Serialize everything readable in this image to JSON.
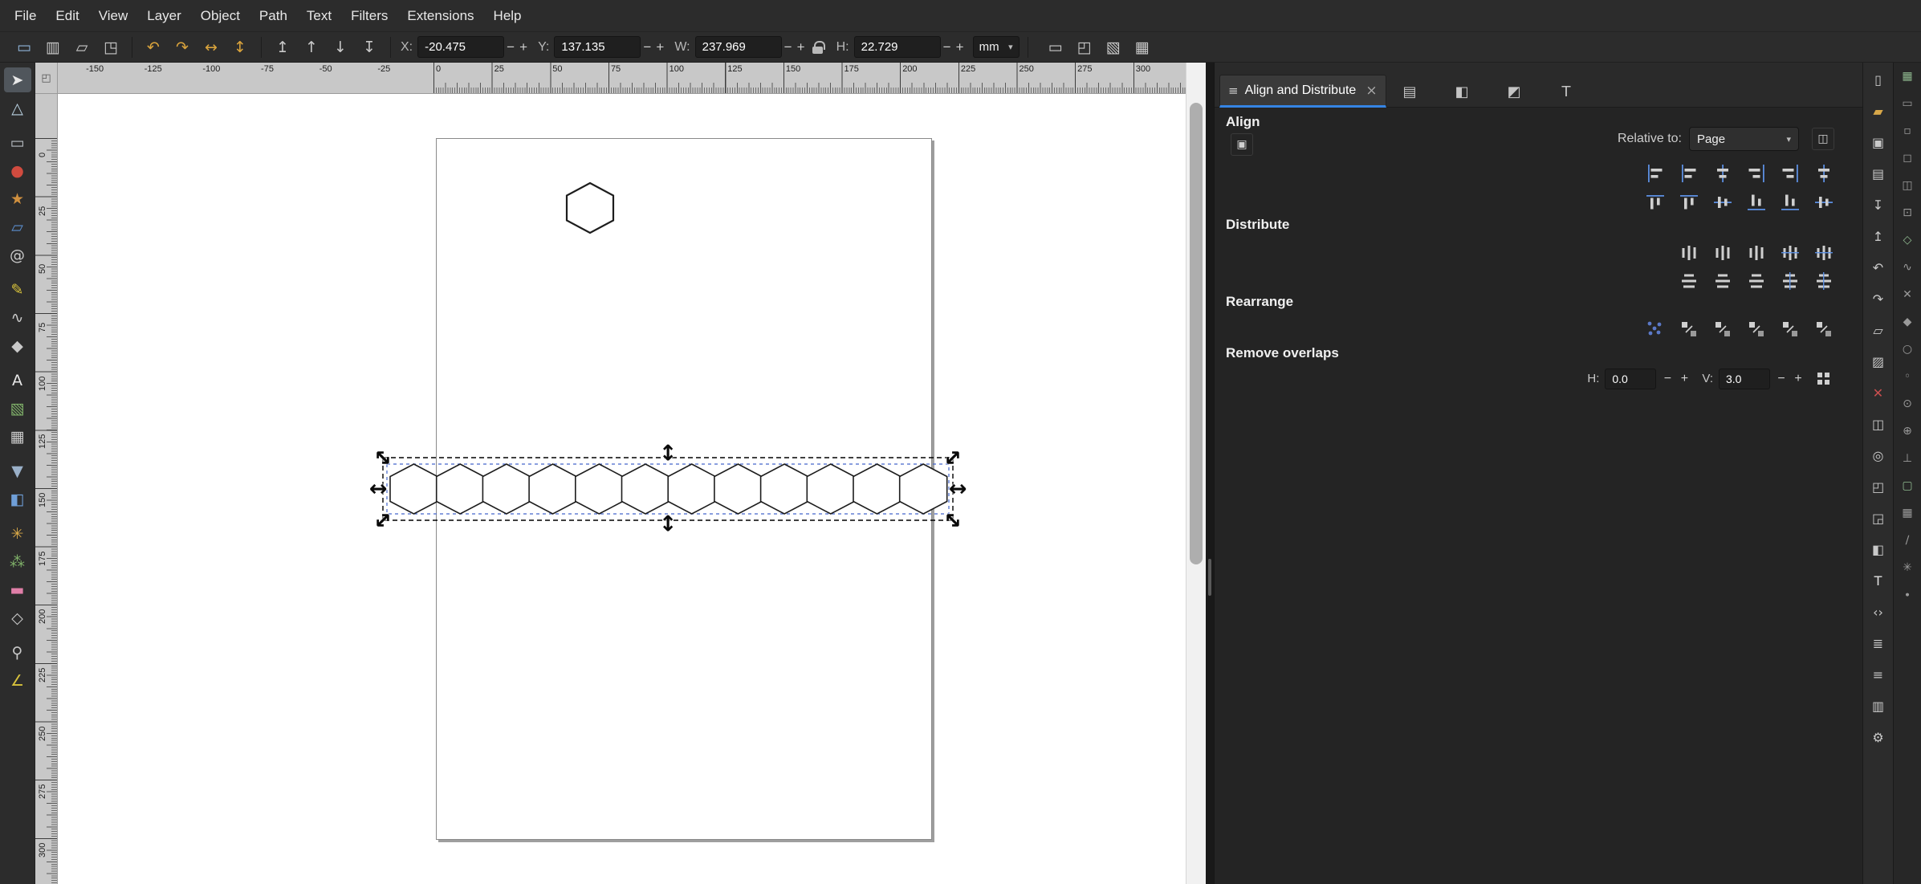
{
  "menubar": {
    "items": [
      "File",
      "Edit",
      "View",
      "Layer",
      "Object",
      "Path",
      "Text",
      "Filters",
      "Extensions",
      "Help"
    ]
  },
  "spinner": {
    "minus": "−",
    "plus": "+"
  },
  "command_toolbar": {
    "groups": [
      [
        {
          "name": "select-all",
          "glyph": "▭",
          "color": "#8fb4d8"
        },
        {
          "name": "select-all-in-all-layers",
          "glyph": "▥",
          "color": "#c9c9c9"
        },
        {
          "name": "deselect",
          "glyph": "▱",
          "color": "#c9c9c9"
        },
        {
          "name": "selection-options",
          "glyph": "◳",
          "color": "#c9c9c9"
        }
      ],
      [
        {
          "name": "rotate-90-ccw",
          "glyph": "↶",
          "color": "#d9a33c"
        },
        {
          "name": "rotate-90-cw",
          "glyph": "↷",
          "color": "#d9a33c"
        },
        {
          "name": "flip-horizontal",
          "glyph": "↔",
          "color": "#d9a33c"
        },
        {
          "name": "flip-vertical",
          "glyph": "↕",
          "color": "#d9a33c"
        }
      ],
      [
        {
          "name": "raise-to-top",
          "glyph": "↥",
          "color": "#c9c9c9"
        },
        {
          "name": "raise",
          "glyph": "↑",
          "color": "#c9c9c9"
        },
        {
          "name": "lower",
          "glyph": "↓",
          "color": "#c9c9c9"
        },
        {
          "name": "lower-to-bottom",
          "glyph": "↧",
          "color": "#c9c9c9"
        }
      ]
    ],
    "fields": [
      {
        "name": "x",
        "label": "X:",
        "value": "-20.475"
      },
      {
        "name": "y",
        "label": "Y:",
        "value": "137.135"
      },
      {
        "name": "w",
        "label": "W:",
        "value": "237.969"
      },
      {
        "name": "h",
        "label": "H:",
        "value": "22.729"
      }
    ],
    "lock_icon_name": "lock-aspect-ratio-toggle",
    "unit_value": "mm",
    "caret_glyph": "▾",
    "right_group": [
      {
        "name": "scale-stroke-with-object",
        "glyph": "▭",
        "color": "#c9c9c9"
      },
      {
        "name": "scale-rounded-corners",
        "glyph": "◰",
        "color": "#c9c9c9"
      },
      {
        "name": "move-gradients-with-object",
        "glyph": "▧",
        "color": "#c9c9c9"
      },
      {
        "name": "move-patterns-with-object",
        "glyph": "▦",
        "color": "#c9c9c9"
      }
    ]
  },
  "toolbox": [
    {
      "name": "selector-tool",
      "glyph": "➤",
      "color": "#e8e8e8",
      "active": true
    },
    {
      "name": "node-tool",
      "glyph": "△",
      "color": "#bcd4e4"
    },
    {
      "name": "rectangle-tool",
      "glyph": "▭",
      "color": "#b9bec4",
      "gap": true
    },
    {
      "name": "ellipse-tool",
      "glyph": "●",
      "color": "#d04b3f"
    },
    {
      "name": "star-tool",
      "glyph": "★",
      "color": "#d0903f"
    },
    {
      "name": "box-3d-tool",
      "glyph": "▱",
      "color": "#5b8fd0"
    },
    {
      "name": "spiral-tool",
      "glyph": "@",
      "color": "#c9c9c9"
    },
    {
      "name": "pencil-tool",
      "glyph": "✎",
      "color": "#d8c23c",
      "gap": true
    },
    {
      "name": "pen-tool",
      "glyph": "∿",
      "color": "#c9c9c9"
    },
    {
      "name": "calligraphy-tool",
      "glyph": "◆",
      "color": "#c9c9c9"
    },
    {
      "name": "text-tool",
      "glyph": "A",
      "color": "#e8e8e8",
      "gap": true
    },
    {
      "name": "gradient-tool",
      "glyph": "▧",
      "color": "#7fb069"
    },
    {
      "name": "mesh-gradient-tool",
      "glyph": "▦",
      "color": "#c9c9c9"
    },
    {
      "name": "dropper-tool",
      "glyph": "▼",
      "color": "#9ab0c8",
      "gap": true
    },
    {
      "name": "paint-bucket-tool",
      "glyph": "◧",
      "color": "#6f9fd8"
    },
    {
      "name": "tweak-tool",
      "glyph": "✳",
      "color": "#d8a849",
      "gap": true
    },
    {
      "name": "spray-tool",
      "glyph": "⁂",
      "color": "#7fb069"
    },
    {
      "name": "eraser-tool",
      "glyph": "▬",
      "color": "#e07fa8"
    },
    {
      "name": "connector-tool",
      "glyph": "◇",
      "color": "#c9c9c9"
    },
    {
      "name": "zoom-tool",
      "glyph": "⚲",
      "color": "#c9c9c9",
      "gap": true
    },
    {
      "name": "measure-tool",
      "glyph": "∠",
      "color": "#d8c23c"
    }
  ],
  "rulers": {
    "horizontal": [
      "-150",
      "-125",
      "-100",
      "-75",
      "-50",
      "-25",
      "0",
      "25",
      "50",
      "75",
      "100",
      "125",
      "150",
      "175",
      "200",
      "225",
      "250",
      "275",
      "300"
    ],
    "vertical": [
      "0",
      "25",
      "50",
      "75",
      "100",
      "125",
      "150",
      "175",
      "200",
      "225",
      "250",
      "275",
      "300"
    ]
  },
  "canvas": {
    "hexagon_row_count": 12,
    "selection_handles": [
      {
        "name": "scale-handle-nw",
        "glyph": "↔",
        "rot": 45
      },
      {
        "name": "scale-handle-n",
        "glyph": "↕",
        "rot": 0
      },
      {
        "name": "scale-handle-ne",
        "glyph": "↔",
        "rot": -45
      },
      {
        "name": "scale-handle-w",
        "glyph": "↔",
        "rot": 0
      },
      {
        "name": "scale-handle-e",
        "glyph": "↔",
        "rot": 0
      },
      {
        "name": "scale-handle-sw",
        "glyph": "↔",
        "rot": -45
      },
      {
        "name": "scale-handle-s",
        "glyph": "↕",
        "rot": 0
      },
      {
        "name": "scale-handle-se",
        "glyph": "↔",
        "rot": 45
      }
    ]
  },
  "corner_icon": {
    "name": "ruler-corner",
    "glyph": "◰"
  },
  "dock": {
    "tab": {
      "icon_glyph": "≡",
      "title": "Align and Distribute",
      "close_glyph": "×"
    },
    "tab_icons": [
      {
        "name": "tab-document-properties",
        "glyph": "▤"
      },
      {
        "name": "tab-export",
        "glyph": "◧"
      },
      {
        "name": "tab-fill-stroke",
        "glyph": "◩"
      },
      {
        "name": "tab-text-and-font",
        "glyph": "T"
      }
    ],
    "align": {
      "title": "Align",
      "group_toggle": {
        "name": "treat-selection-as-group",
        "glyph": "▣"
      },
      "relative_label": "Relative to:",
      "relative_value": "Page",
      "caret_glyph": "▾",
      "move_as_group": {
        "name": "move-as-group",
        "glyph": "◫"
      },
      "row1": [
        "align-right-to-anchor-left",
        "align-left-edges",
        "center-on-vertical-axis",
        "align-right-edges",
        "align-left-to-anchor-right",
        "align-text-horizontal"
      ],
      "row2": [
        "align-bottom-to-anchor-top",
        "align-top-edges",
        "center-on-horizontal-axis",
        "align-bottom-edges",
        "align-top-to-anchor-bottom",
        "align-text-vertical"
      ]
    },
    "distribute": {
      "title": "Distribute",
      "row1": [
        "distribute-left-edges",
        "distribute-centers-horizontally",
        "distribute-right-edges",
        "distribute-equal-gaps-horizontally",
        "distribute-text-anchors-horizontally"
      ],
      "row2": [
        "distribute-top-edges",
        "distribute-centers-vertically",
        "distribute-bottom-edges",
        "distribute-equal-gaps-vertically",
        "distribute-text-anchors-vertically"
      ]
    },
    "rearrange": {
      "title": "Rearrange",
      "row": [
        "arrange-as-graph",
        "exchange-in-selection-order",
        "exchange-in-stacking-order",
        "exchange-clockwise",
        "randomize-centers",
        "unclump"
      ]
    },
    "remove_overlaps": {
      "title": "Remove overlaps",
      "h_label": "H:",
      "h_value": "0.0",
      "v_label": "V:",
      "v_value": "3.0",
      "button": {
        "name": "remove-overlaps-apply",
        "glyph": "▦"
      }
    }
  },
  "right_bars": {
    "commands": [
      {
        "name": "new-document",
        "glyph": "▯",
        "color": "#c9c9c9"
      },
      {
        "name": "open-document",
        "glyph": "▰",
        "color": "#d8a849"
      },
      {
        "name": "save-document",
        "glyph": "▣",
        "color": "#c9c9c9"
      },
      {
        "name": "print-document",
        "glyph": "▤",
        "color": "#c9c9c9"
      },
      {
        "name": "import-image",
        "glyph": "↧",
        "color": "#c9c9c9"
      },
      {
        "name": "export-image",
        "glyph": "↥",
        "color": "#c9c9c9"
      },
      {
        "name": "undo",
        "glyph": "↶",
        "color": "#c9c9c9"
      },
      {
        "name": "redo",
        "glyph": "↷",
        "color": "#c9c9c9"
      },
      {
        "name": "copy",
        "glyph": "▱",
        "color": "#c9c9c9"
      },
      {
        "name": "paste",
        "glyph": "▨",
        "color": "#c9c9c9"
      },
      {
        "name": "delete-selection",
        "glyph": "✕",
        "color": "#c94f4f"
      },
      {
        "name": "duplicate",
        "glyph": "◫",
        "color": "#c9c9c9"
      },
      {
        "name": "create-clone",
        "glyph": "◎",
        "color": "#c9c9c9"
      },
      {
        "name": "group-objects",
        "glyph": "◰",
        "color": "#c9c9c9"
      },
      {
        "name": "ungroup-objects",
        "glyph": "◲",
        "color": "#c9c9c9"
      },
      {
        "name": "fill-and-stroke-dialog",
        "glyph": "◧",
        "color": "#c9c9c9"
      },
      {
        "name": "text-dialog",
        "glyph": "T",
        "color": "#e0e0e0"
      },
      {
        "name": "xml-editor",
        "glyph": "‹›",
        "color": "#c9c9c9"
      },
      {
        "name": "layers-dialog",
        "glyph": "≣",
        "color": "#c9c9c9"
      },
      {
        "name": "align-dialog",
        "glyph": "≡",
        "color": "#c9c9c9"
      },
      {
        "name": "document-properties",
        "glyph": "▥",
        "color": "#c9c9c9"
      },
      {
        "name": "preferences",
        "glyph": "⚙",
        "color": "#c9c9c9"
      }
    ],
    "snap": [
      {
        "name": "snap-enabled",
        "glyph": "▦",
        "color": "#8fb98f"
      },
      {
        "name": "snap-bounding-box",
        "glyph": "▭",
        "color": "#9a9a9a"
      },
      {
        "name": "snap-bbox-edges",
        "glyph": "▫",
        "color": "#9a9a9a"
      },
      {
        "name": "snap-bbox-corners",
        "glyph": "◻",
        "color": "#9a9a9a"
      },
      {
        "name": "snap-bbox-edge-midpoints",
        "glyph": "◫",
        "color": "#9a9a9a"
      },
      {
        "name": "snap-bbox-centers",
        "glyph": "⊡",
        "color": "#9a9a9a"
      },
      {
        "name": "snap-nodes",
        "glyph": "◇",
        "color": "#8fb98f"
      },
      {
        "name": "snap-paths",
        "glyph": "∿",
        "color": "#9a9a9a"
      },
      {
        "name": "snap-path-intersections",
        "glyph": "✕",
        "color": "#9a9a9a"
      },
      {
        "name": "snap-cusp-nodes",
        "glyph": "◆",
        "color": "#9a9a9a"
      },
      {
        "name": "snap-smooth-nodes",
        "glyph": "○",
        "color": "#9a9a9a"
      },
      {
        "name": "snap-line-midpoints",
        "glyph": "◦",
        "color": "#9a9a9a"
      },
      {
        "name": "snap-object-centers",
        "glyph": "⊙",
        "color": "#9a9a9a"
      },
      {
        "name": "snap-rotation-centers",
        "glyph": "⊕",
        "color": "#9a9a9a"
      },
      {
        "name": "snap-text-baselines",
        "glyph": "⊥",
        "color": "#9a9a9a"
      },
      {
        "name": "snap-page-border",
        "glyph": "▢",
        "color": "#8fb98f"
      },
      {
        "name": "snap-grids",
        "glyph": "▦",
        "color": "#9a9a9a"
      },
      {
        "name": "snap-guides",
        "glyph": "∕",
        "color": "#9a9a9a"
      },
      {
        "name": "snap-guide-intersections",
        "glyph": "✳",
        "color": "#9a9a9a"
      },
      {
        "name": "snap-midpoints",
        "glyph": "∙",
        "color": "#9a9a9a"
      }
    ]
  }
}
